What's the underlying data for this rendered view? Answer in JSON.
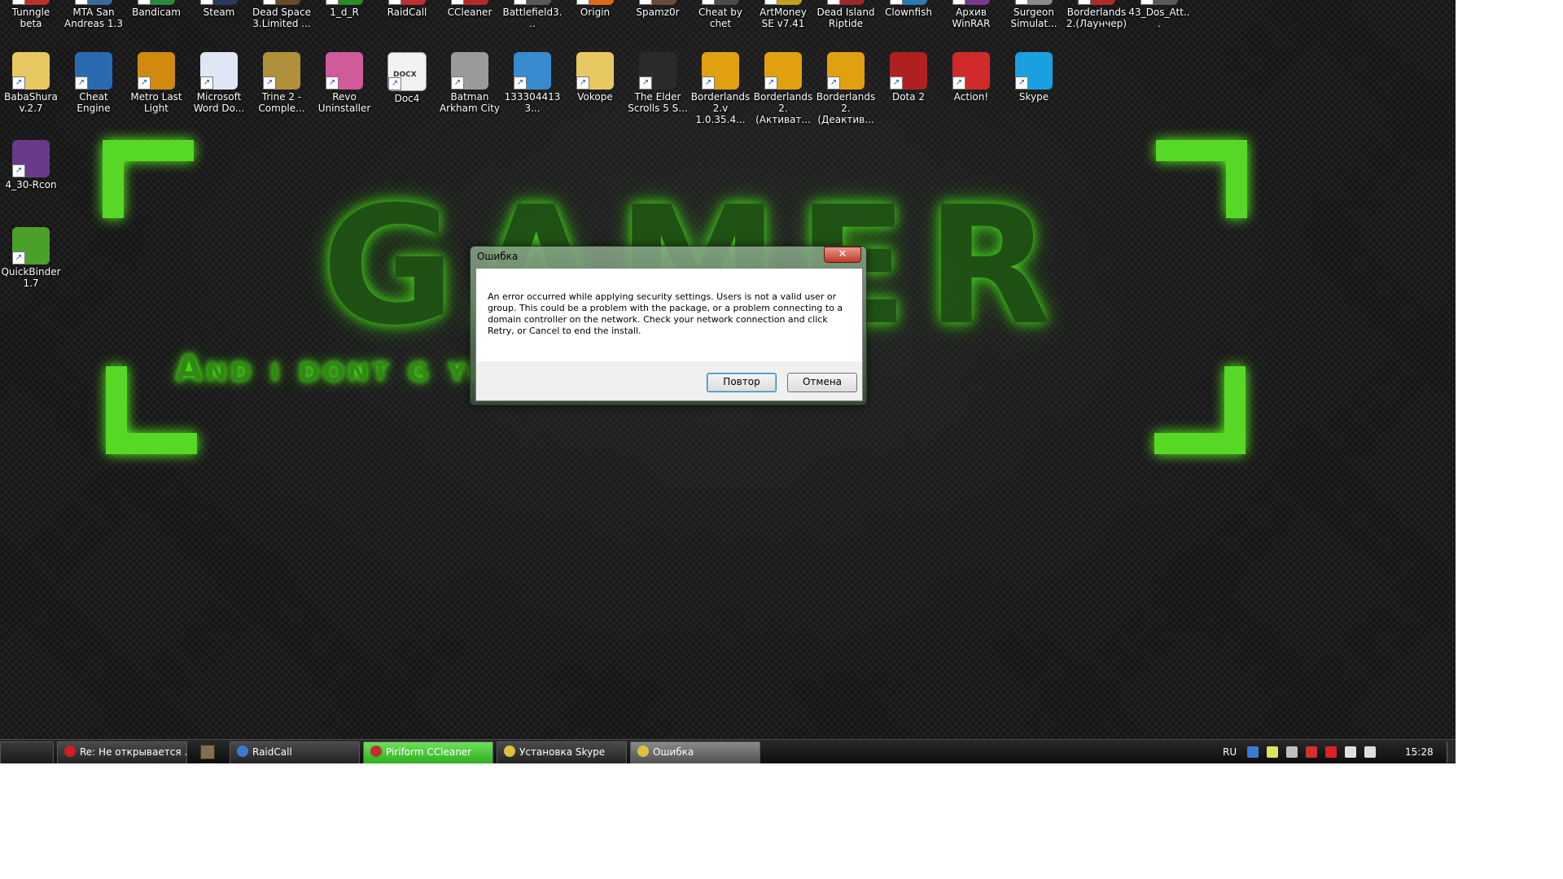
{
  "desktop": {
    "icons_row1": [
      {
        "label": "Tunngle beta",
        "color": "#b8322a"
      },
      {
        "label": "MTA San Andreas 1.3",
        "color": "#3a6a9a"
      },
      {
        "label": "Bandicam",
        "color": "#2a8a3a"
      },
      {
        "label": "Steam",
        "color": "#2a3a5a"
      },
      {
        "label": "Dead Space 3.Limited ...",
        "color": "#6a4a2a"
      },
      {
        "label": "1_d_R",
        "color": "#2a8a2a"
      },
      {
        "label": "RaidCall",
        "color": "#c03030"
      },
      {
        "label": "CCleaner",
        "color": "#b82a2a"
      },
      {
        "label": "Battlefield3...",
        "color": "#5a5a5a"
      },
      {
        "label": "Origin",
        "color": "#e06a1a"
      },
      {
        "label": "Spamz0r",
        "color": "#6a4a3a"
      },
      {
        "label": "Cheat by chet",
        "color": "#4a4a4a"
      },
      {
        "label": "ArtMoney SE v7.41",
        "color": "#c0a020"
      },
      {
        "label": "Dead Island Riptide",
        "color": "#9a2a2a"
      },
      {
        "label": "Clownfish",
        "color": "#2a7ab0"
      },
      {
        "label": "Архив WinRAR",
        "color": "#7a3a8a"
      },
      {
        "label": "Surgeon Simulat...",
        "color": "#8a8a8a"
      },
      {
        "label": "Borderlands 2.(Лаунчер)",
        "color": "#b02a2a"
      },
      {
        "label": "43_Dos_Att...",
        "color": "#5a5a5a"
      }
    ],
    "icons_row2": [
      {
        "label": "BabaShura v.2.7",
        "color": "#e8c860"
      },
      {
        "label": "Cheat Engine",
        "color": "#2a6ab0"
      },
      {
        "label": "Metro Last Light",
        "color": "#d08a10"
      },
      {
        "label": "Microsoft Word Do...",
        "color": "#dfe6f5"
      },
      {
        "label": "Trine 2 - Comple...",
        "color": "#b0903a"
      },
      {
        "label": "Revo Uninstaller",
        "color": "#d05a9a"
      },
      {
        "label": "Doc4",
        "color": "#f2f2f2"
      },
      {
        "label": "Batman Arkham City",
        "color": "#9a9a9a"
      },
      {
        "label": "1333044133...",
        "color": "#3a8ad0"
      },
      {
        "label": "Vokope",
        "color": "#e8c860"
      },
      {
        "label": "The Elder Scrolls 5 S...",
        "color": "#2a2a2a"
      },
      {
        "label": "Borderlands 2.v 1.0.35.4...",
        "color": "#e0a010"
      },
      {
        "label": "Borderlands 2.(Активат...",
        "color": "#e0a010"
      },
      {
        "label": "Borderlands 2.(Деактив...",
        "color": "#e0a010"
      },
      {
        "label": "Dota 2",
        "color": "#b02020"
      },
      {
        "label": "Action!",
        "color": "#d02a2a"
      },
      {
        "label": "Skype",
        "color": "#1aa0e0"
      }
    ],
    "icons_col": [
      {
        "label": "4_30-Rcon",
        "color": "#6a3a8a"
      },
      {
        "label": "QuickBinder 1.7",
        "color": "#4aa02a"
      }
    ],
    "doc_badge": "DOCX"
  },
  "wallpaper": {
    "big_text": "GAMER",
    "small_text": "And i dont g          your opinion."
  },
  "dialog": {
    "title": "Ошибка",
    "close_glyph": "✕",
    "message": "An error occurred while applying security settings. Users is not a valid user or group. This could be a problem with the package, or a problem connecting to a domain controller on the network. Check your network connection and click Retry, or Cancel to end the install.",
    "retry_label": "Повтор",
    "cancel_label": "Отмена"
  },
  "taskbar": {
    "items": [
      {
        "label": "Re: Не открывается ...",
        "color": "#d02020"
      },
      {
        "label": "RaidCall",
        "color": "#3a7ad0"
      },
      {
        "label": "Piriform CCleaner",
        "color": "#c03030"
      },
      {
        "label": "Установка Skype",
        "color": "#e0c040"
      },
      {
        "label": "Ошибка",
        "color": "#e0c040"
      }
    ],
    "language": "RU",
    "clock": "15:28",
    "tray_icons": [
      "raidcall-icon",
      "chat-icon",
      "network-tool-icon",
      "speaker-muted-icon",
      "opera-icon",
      "network-icon",
      "volume-icon"
    ]
  }
}
